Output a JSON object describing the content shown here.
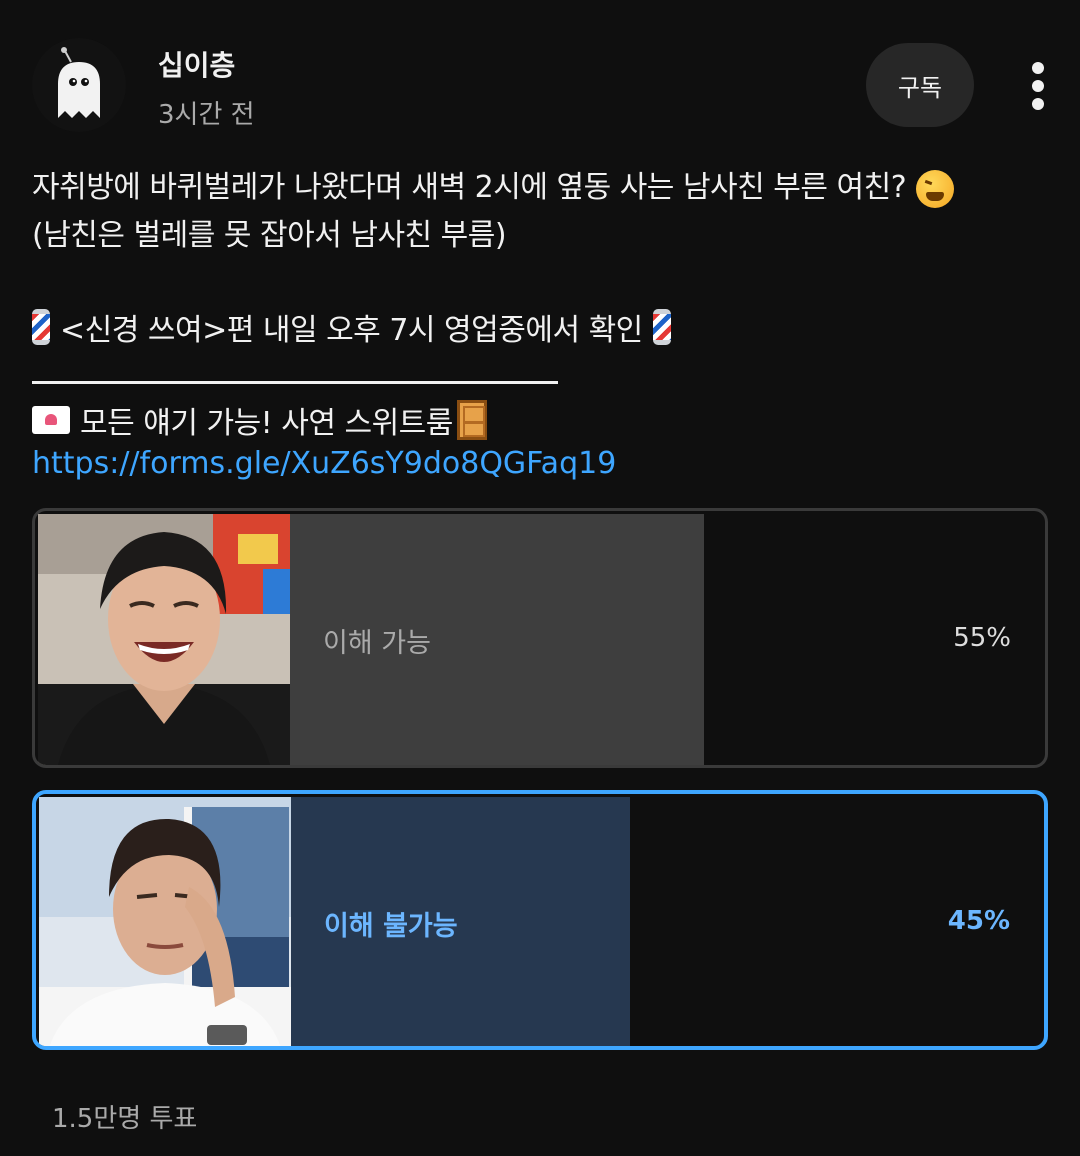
{
  "channel": {
    "name": "십이층",
    "time": "3시간 전",
    "subscribe_label": "구독"
  },
  "post": {
    "line1": "자취방에 바퀴벌레가 나왔다며 새벽 2시에 옆동 사는 남사친 부른 여친?",
    "line2": "(남친은 벌레를 못 잡아서 남사친 부름)",
    "line3": "<신경 쓰여>편 내일 오후 7시 영업중에서 확인",
    "line4": "모든 얘기 가능! 사연 스위트룸",
    "link": "https://forms.gle/XuZ6sY9do8QGFaq19"
  },
  "icons": {
    "avatar": "ghost-avatar-icon",
    "menu": "more-vertical-icon",
    "tired_face": "tired-face-emoji-icon",
    "barber_pole": "barber-pole-emoji-icon",
    "love_letter": "love-letter-emoji-icon",
    "door": "door-emoji-icon"
  },
  "poll": {
    "options": [
      {
        "label": "이해 가능",
        "percent": "55%",
        "value": 55,
        "selected": false
      },
      {
        "label": "이해 불가능",
        "percent": "45%",
        "value": 45,
        "selected": true
      }
    ],
    "votes": "1.5만명 투표"
  },
  "colors": {
    "accent": "#3ea6ff",
    "background": "#0f0f0f",
    "selected_fill": "#263850",
    "unselected_fill": "#3e3e3e"
  }
}
